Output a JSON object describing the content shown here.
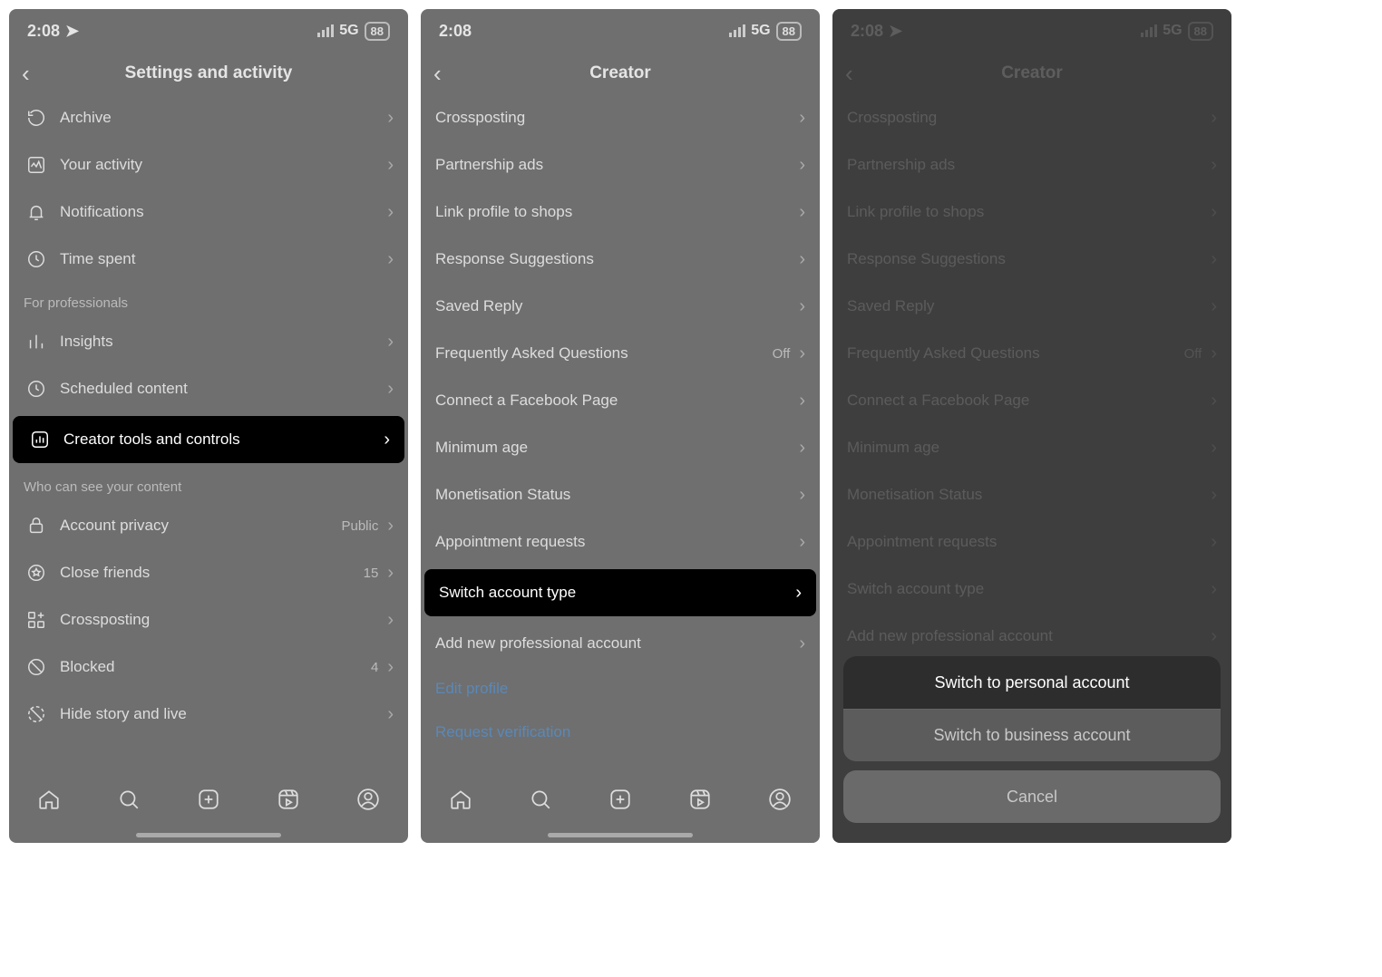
{
  "status": {
    "time": "2:08",
    "network": "5G",
    "battery": "88"
  },
  "panel1": {
    "title": "Settings and activity",
    "how_you_use": [
      {
        "icon": "archive",
        "label": "Archive"
      },
      {
        "icon": "activity",
        "label": "Your activity"
      },
      {
        "icon": "bell",
        "label": "Notifications"
      },
      {
        "icon": "clock",
        "label": "Time spent"
      }
    ],
    "section2_header": "For professionals",
    "professionals": [
      {
        "icon": "insights",
        "label": "Insights"
      },
      {
        "icon": "clock",
        "label": "Scheduled content"
      },
      {
        "icon": "bars-square",
        "label": "Creator tools and controls",
        "highlight": true
      }
    ],
    "section3_header": "Who can see your content",
    "privacy_rows": [
      {
        "icon": "lock",
        "label": "Account privacy",
        "value": "Public"
      },
      {
        "icon": "star",
        "label": "Close friends",
        "value": "15"
      },
      {
        "icon": "grid-plus",
        "label": "Crossposting"
      },
      {
        "icon": "no",
        "label": "Blocked",
        "value": "4"
      },
      {
        "icon": "hide",
        "label": "Hide story and live"
      }
    ]
  },
  "panel2": {
    "title": "Creator",
    "rows": [
      {
        "label": "Crossposting"
      },
      {
        "label": "Partnership ads"
      },
      {
        "label": "Link profile to shops"
      },
      {
        "label": "Response Suggestions"
      },
      {
        "label": "Saved Reply"
      },
      {
        "label": "Frequently Asked Questions",
        "value": "Off"
      },
      {
        "label": "Connect a Facebook Page"
      },
      {
        "label": "Minimum age"
      },
      {
        "label": "Monetisation Status"
      },
      {
        "label": "Appointment requests"
      },
      {
        "label": "Switch account type",
        "highlight": true
      },
      {
        "label": "Add new professional account"
      }
    ],
    "links": [
      "Edit profile",
      "Request verification"
    ]
  },
  "panel3": {
    "title": "Creator",
    "rows": [
      {
        "label": "Crossposting"
      },
      {
        "label": "Partnership ads"
      },
      {
        "label": "Link profile to shops"
      },
      {
        "label": "Response Suggestions"
      },
      {
        "label": "Saved Reply"
      },
      {
        "label": "Frequently Asked Questions",
        "value": "Off"
      },
      {
        "label": "Connect a Facebook Page"
      },
      {
        "label": "Minimum age"
      },
      {
        "label": "Monetisation Status"
      },
      {
        "label": "Appointment requests"
      },
      {
        "label": "Switch account type"
      },
      {
        "label": "Add new professional account"
      }
    ],
    "sheet": {
      "option1": "Switch to personal account",
      "option2": "Switch to business account",
      "cancel": "Cancel"
    }
  }
}
